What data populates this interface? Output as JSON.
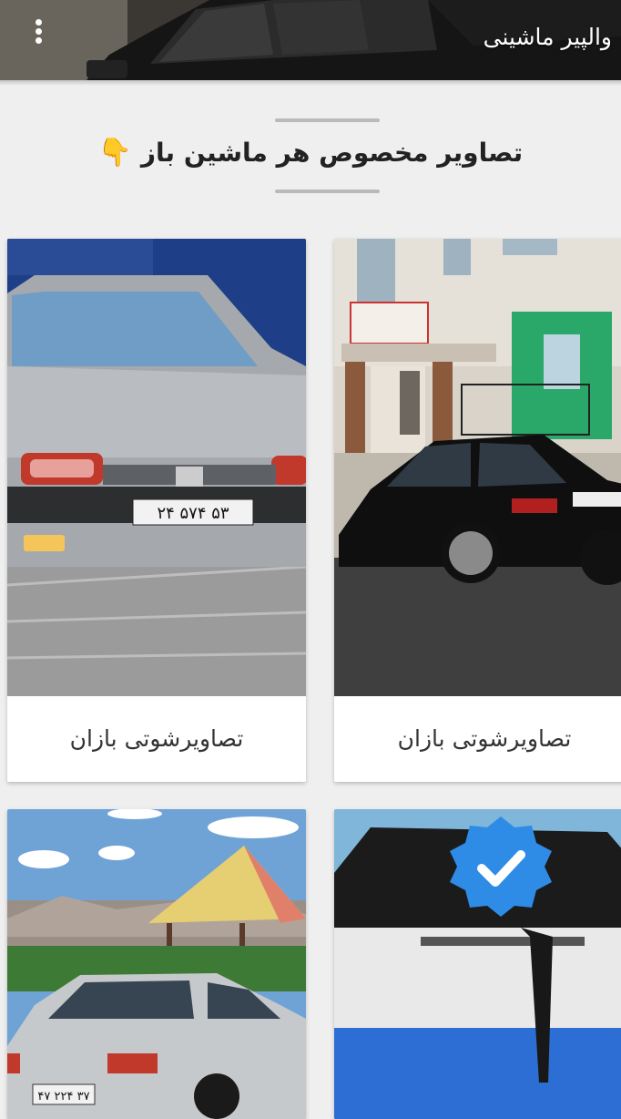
{
  "app_bar": {
    "title": "والپیر ماشینی",
    "menu_icon": "more-vert-icon"
  },
  "section": {
    "title": "تصاویر مخصوص هر ماشین باز",
    "emoji": "👇"
  },
  "cards": [
    {
      "label": "تصاویرشوتی بازان",
      "image": "black-peugeot-405-photo"
    },
    {
      "label": "تصاویرشوتی بازان",
      "image": "silver-peugeot-pars-photo",
      "plate": "۲۴ ۵۷۴ ۵۳"
    },
    {
      "label": "",
      "image": "blue-pickup-truck-photo",
      "badge_icon": "verified-check-icon"
    },
    {
      "label": "",
      "image": "silver-peugeot-405-gazebo-photo",
      "plate": "۴۷ ۲۲۴ ۳۷"
    }
  ],
  "colors": {
    "background": "#efefef",
    "card": "#ffffff",
    "verified_badge": "#2e8be6"
  }
}
